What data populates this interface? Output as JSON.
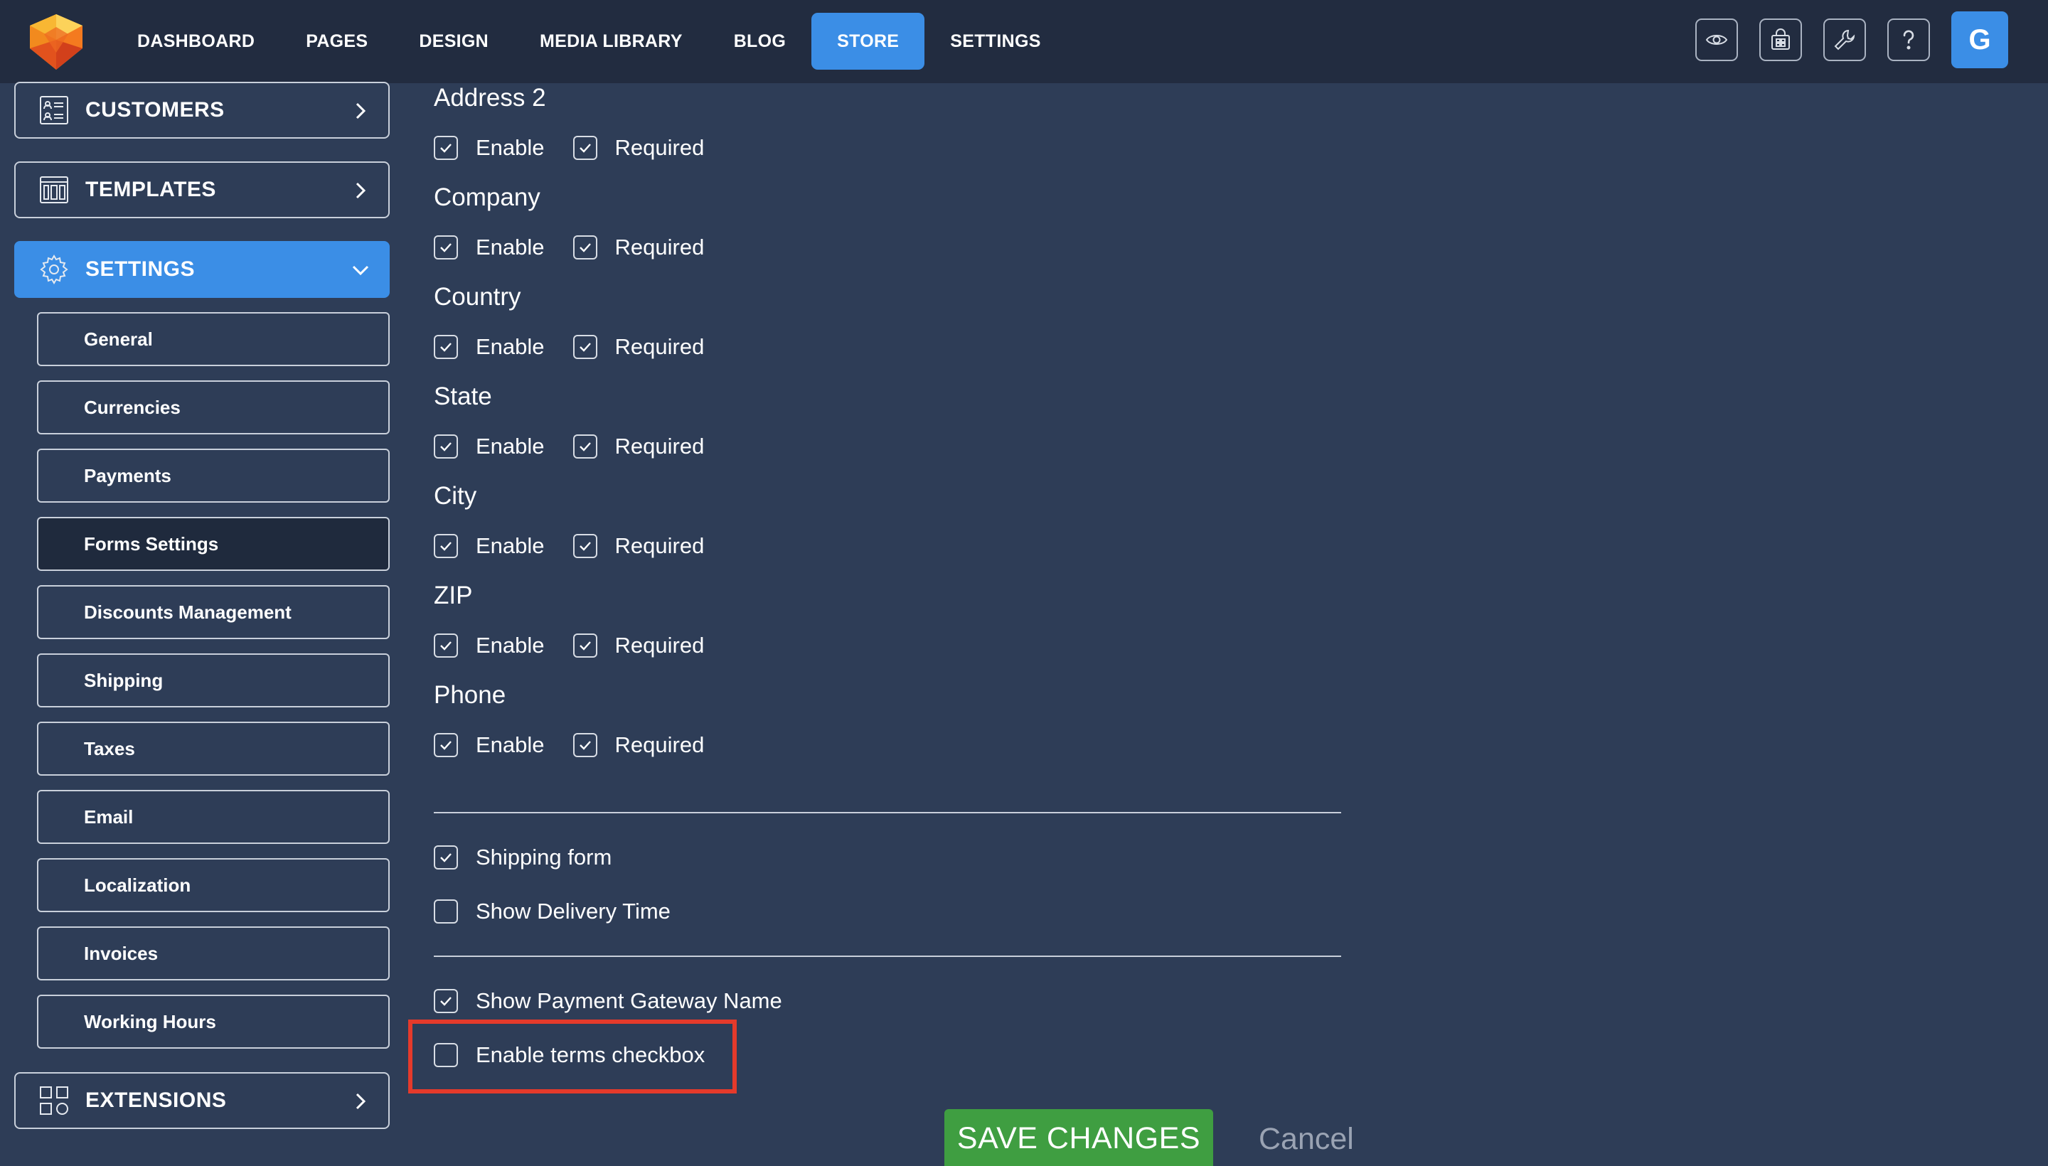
{
  "topbar": {
    "nav": [
      {
        "label": "DASHBOARD",
        "active": false
      },
      {
        "label": "PAGES",
        "active": false
      },
      {
        "label": "DESIGN",
        "active": false
      },
      {
        "label": "MEDIA LIBRARY",
        "active": false
      },
      {
        "label": "BLOG",
        "active": false
      },
      {
        "label": "STORE",
        "active": true
      },
      {
        "label": "SETTINGS",
        "active": false
      }
    ],
    "icons": [
      "preview-eye-icon",
      "store-bag-icon",
      "wrench-icon",
      "help-icon"
    ],
    "avatar_letter": "G"
  },
  "sidebar": {
    "customers": "CUSTOMERS",
    "templates": "TEMPLATES",
    "settings": "SETTINGS",
    "extensions": "EXTENSIONS",
    "settings_items": [
      "General",
      "Currencies",
      "Payments",
      "Forms Settings",
      "Discounts Management",
      "Shipping",
      "Taxes",
      "Email",
      "Localization",
      "Invoices",
      "Working Hours"
    ],
    "active_item": "Forms Settings"
  },
  "form": {
    "enable_label": "Enable",
    "required_label": "Required",
    "fields": [
      {
        "title": "Address 2",
        "enable": true,
        "required": true
      },
      {
        "title": "Company",
        "enable": true,
        "required": true
      },
      {
        "title": "Country",
        "enable": true,
        "required": true
      },
      {
        "title": "State",
        "enable": true,
        "required": true
      },
      {
        "title": "City",
        "enable": true,
        "required": true
      },
      {
        "title": "ZIP",
        "enable": true,
        "required": true
      },
      {
        "title": "Phone",
        "enable": true,
        "required": true
      }
    ],
    "options": [
      {
        "label": "Shipping form",
        "checked": true
      },
      {
        "label": "Show Delivery Time",
        "checked": false
      },
      {
        "label": "Show Payment Gateway Name",
        "checked": true
      },
      {
        "label": "Enable terms checkbox",
        "checked": false
      }
    ],
    "save_label": "SAVE CHANGES",
    "cancel_label": "Cancel"
  },
  "colors": {
    "topbar": "#222c40",
    "background": "#2e3d57",
    "accent": "#3b8ee6",
    "save": "#3f9e41",
    "highlight": "#e53a2b"
  }
}
